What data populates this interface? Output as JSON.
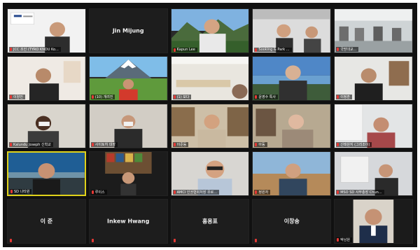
{
  "tiles": [
    {
      "label": "JCC 조인 (TYRO KNDU Ko..."
    },
    {
      "center": "Jin Mijung"
    },
    {
      "label": "Kapun Lee"
    },
    {
      "label": "Sooking & Park ..."
    },
    {
      "label": "국방대교..."
    },
    {
      "label": "이양진"
    },
    {
      "label": "(10) 개려진"
    },
    {
      "label": "(1) 보다"
    },
    {
      "label": "윤영수 특사"
    },
    {
      "label": "이정훈"
    },
    {
      "label": "Kalundu Joseph 신학교"
    },
    {
      "label": "사이토히 대장"
    },
    {
      "label": "이준동"
    },
    {
      "label": "아동"
    },
    {
      "label": "신태원지 (그리조이)"
    },
    {
      "label": "SD 나타원"
    },
    {
      "label": "루이스"
    },
    {
      "label": "AMCI 인권협회처장 유로..."
    },
    {
      "label": "정원자"
    },
    {
      "label": "MSO SD 사무총장 Chun..."
    },
    {
      "center": "이 준",
      "label": "이 준"
    },
    {
      "center": "Inkew Hwang",
      "label": "Inkew Hwang"
    },
    {
      "center": "홍용표",
      "label": "홍용표"
    },
    {
      "center": "이창송",
      "label": "이창송"
    },
    {
      "label": "박남원"
    }
  ]
}
